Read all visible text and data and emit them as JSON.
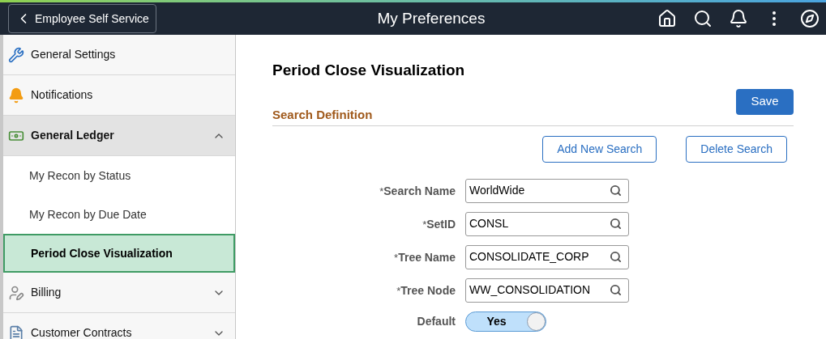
{
  "header": {
    "back_button": "Employee Self Service",
    "title": "My Preferences"
  },
  "sidebar": {
    "items": [
      {
        "kind": "section",
        "label": "General Settings"
      },
      {
        "kind": "section",
        "label": "Notifications"
      },
      {
        "kind": "group",
        "label": "General Ledger",
        "expanded": true,
        "children": [
          {
            "label": "My Recon by Status",
            "selected": false
          },
          {
            "label": "My Recon by Due Date",
            "selected": false
          },
          {
            "label": "Period Close Visualization",
            "selected": true
          }
        ]
      },
      {
        "kind": "group",
        "label": "Billing",
        "expanded": false
      },
      {
        "kind": "group",
        "label": "Customer Contracts",
        "expanded": false
      }
    ]
  },
  "content": {
    "title": "Period Close Visualization",
    "save_button": "Save",
    "section_title": "Search Definition",
    "actions": [
      "Add New Search",
      "Delete Search"
    ],
    "fields": [
      {
        "kind": "lookup",
        "required_mark": "*",
        "label": "Search Name",
        "value": "WorldWide"
      },
      {
        "kind": "lookup",
        "required_mark": "*",
        "label": "SetID",
        "value": "CONSL"
      },
      {
        "kind": "lookup",
        "required_mark": "*",
        "label": "Tree Name",
        "value": "CONSOLIDATE_CORP"
      },
      {
        "kind": "lookup",
        "required_mark": "*",
        "label": "Tree Node",
        "value": "WW_CONSOLIDATION"
      },
      {
        "kind": "toggle",
        "label": "Default",
        "on": true,
        "value": "Yes"
      }
    ]
  }
}
